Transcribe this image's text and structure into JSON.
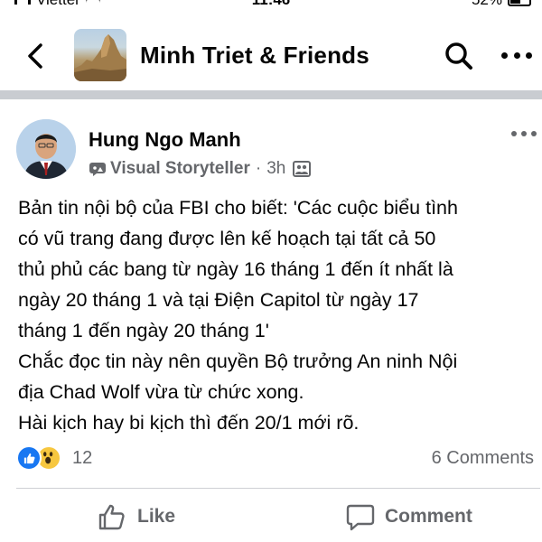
{
  "status_bar": {
    "carrier": "Viettel",
    "time": "11:46",
    "battery": "52%"
  },
  "header": {
    "title": "Minh Triet & Friends",
    "icons": [
      "chevron-left-icon",
      "group-cover-image",
      "search-icon",
      "more-horizontal-icon"
    ]
  },
  "post": {
    "author": "Hung Ngo Manh",
    "badge": "Visual Storyteller",
    "time": "3h",
    "icons": [
      "visual-storyteller-badge-icon",
      "audience-group-icon",
      "more-horizontal-icon"
    ],
    "body_lines": [
      "Bản tin nội bộ của FBI cho biết: 'Các cuộc biểu tình",
      "có vũ trang đang được lên kế hoạch tại tất cả 50",
      "thủ phủ các bang từ ngày 16 tháng 1 đến ít nhất là",
      "ngày 20 tháng 1 và tại Điện Capitol từ ngày 17",
      "tháng 1 đến ngày 20 tháng 1'",
      "Chắc đọc tin này nên quyền Bộ trưởng An ninh Nội",
      "địa Chad Wolf vừa từ chức xong.",
      "Hài kịch hay bi kịch thì đến 20/1 mới rõ."
    ],
    "reactions": {
      "types": [
        "like",
        "wow"
      ],
      "count": "12"
    },
    "comments_count": "6 Comments",
    "actions": {
      "like_label": "Like",
      "comment_label": "Comment"
    }
  },
  "colors": {
    "separator": "#c9ccd1",
    "secondary_text": "#65676b",
    "like_blue": "#1877f2",
    "wow_yellow": "#f7c73f"
  }
}
